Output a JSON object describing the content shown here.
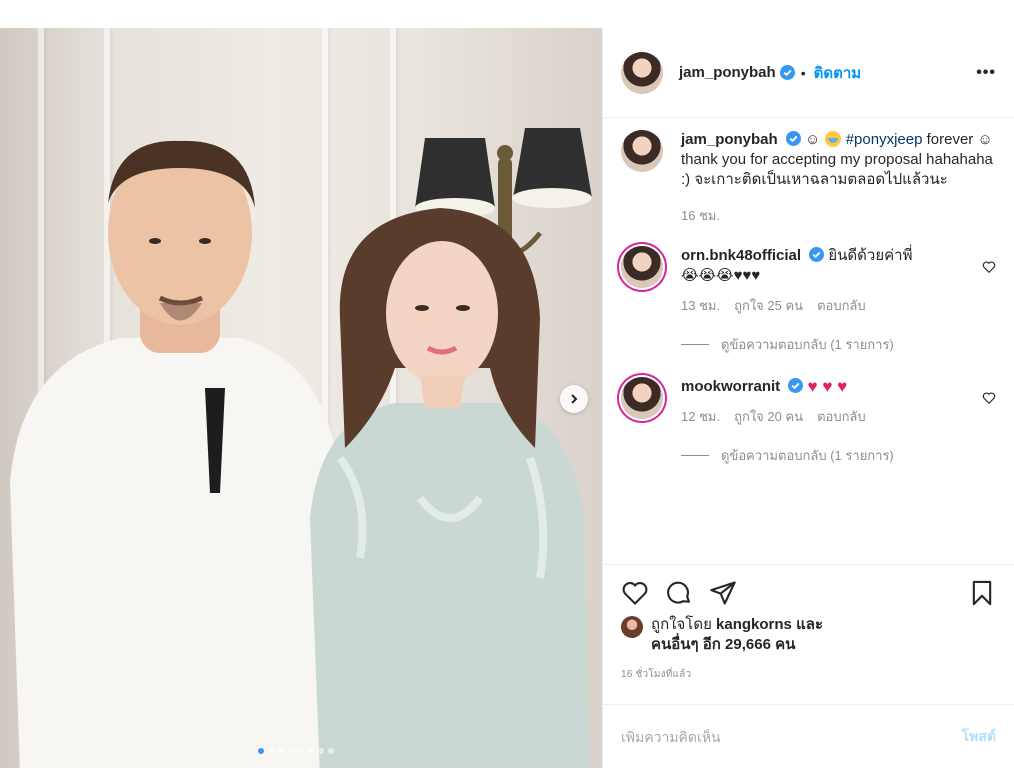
{
  "post": {
    "username": "jam_ponybah",
    "separator": "•",
    "follow_label": "ติดตาม",
    "more_label": "•••"
  },
  "caption": {
    "username": "jam_ponybah",
    "text_before": "☺",
    "hashtag": "#ponyxjeep",
    "text_after": "forever ☺ thank you for accepting my proposal hahahaha :) จะเกาะติดเป็นเหาฉลามตลอดไปแล้วนะ",
    "time": "16 ชม."
  },
  "comments": [
    {
      "username": "orn.bnk48official",
      "text": "ยินดีด้วยค่าพี่",
      "emoji_text": "😭😭😭♥♥♥",
      "time": "13 ชม.",
      "likes": "ถูกใจ 25 คน",
      "reply": "ตอบกลับ",
      "view_replies": "ดูข้อความตอบกลับ (1 รายการ)"
    },
    {
      "username": "mookworranit",
      "text": "",
      "emoji_text": "♥ ♥ ♥",
      "time": "12 ชม.",
      "likes": "ถูกใจ 20 คน",
      "reply": "ตอบกลับ",
      "view_replies": "ดูข้อความตอบกลับ (1 รายการ)"
    }
  ],
  "engagement": {
    "liked_by_prefix": "ถูกใจโดย",
    "liked_by_user": "kangkorns",
    "and": "และ",
    "others": "คนอื่นๆ อีก 29,666 คน",
    "time_ago": "16 ชั่วโมงที่แล้ว"
  },
  "composer": {
    "placeholder": "เพิ่มความคิดเห็น",
    "post_label": "โพสต์"
  },
  "carousel": {
    "slide_count": 8,
    "active_index": 0
  },
  "colors": {
    "link": "#0095f6",
    "hashtag": "#00376b",
    "muted": "#8e8e8e",
    "heart": "#e0245e",
    "verified": "#3897f0",
    "story_ring": "#d6249f"
  },
  "icons": [
    "heart-icon",
    "comment-icon",
    "share-icon",
    "bookmark-icon",
    "verified-icon",
    "chevron-right-icon"
  ]
}
